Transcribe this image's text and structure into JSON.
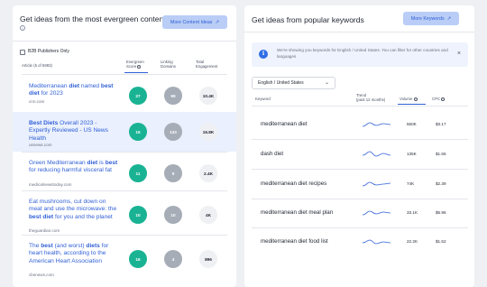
{
  "left_panel": {
    "title": "Get ideas from the most evergreen content",
    "button_label": "More Content Ideas",
    "checkbox_label": "B2B Publishers Only",
    "col_article": "Article (5 of 5993)",
    "col_evergreen_1": "Evergreen",
    "col_evergreen_2": "Score",
    "col_linking_1": "Linking",
    "col_linking_2": "Domains",
    "col_total_1": "Total",
    "col_total_2": "Engagement",
    "articles": [
      {
        "segs": [
          {
            "t": "Mediterranean ",
            "b": false
          },
          {
            "t": "diet",
            "b": true
          },
          {
            "t": " named ",
            "b": false
          },
          {
            "t": "best diet",
            "b": true
          },
          {
            "t": " for 2023",
            "b": false
          }
        ],
        "domain": "cnn.com",
        "score": "27",
        "linking": "99",
        "engagement": "10.4K"
      },
      {
        "segs": [
          {
            "t": "Best Diets",
            "b": true
          },
          {
            "t": " Overall 2023 - Expertly Reviewed - US News Health",
            "b": false
          }
        ],
        "domain": "usnews.com",
        "score": "15",
        "linking": "133",
        "engagement": "16.8K"
      },
      {
        "segs": [
          {
            "t": "Green Mediterranean ",
            "b": false
          },
          {
            "t": "diet",
            "b": true
          },
          {
            "t": " is ",
            "b": false
          },
          {
            "t": "best",
            "b": true
          },
          {
            "t": " for reducing harmful visceral fat",
            "b": false
          }
        ],
        "domain": "medicalnewstoday.com",
        "score": "11",
        "linking": "9",
        "engagement": "2.4K"
      },
      {
        "segs": [
          {
            "t": "Eat mushrooms, cut down on meat and use the microwave: the ",
            "b": false
          },
          {
            "t": "best diet",
            "b": true
          },
          {
            "t": " for you and the planet",
            "b": false
          }
        ],
        "domain": "theguardian.com",
        "score": "10",
        "linking": "10",
        "engagement": "4K"
      },
      {
        "segs": [
          {
            "t": "The ",
            "b": false
          },
          {
            "t": "best",
            "b": true
          },
          {
            "t": " (and worst) ",
            "b": false
          },
          {
            "t": "diets",
            "b": true
          },
          {
            "t": " for heart health, according to the American Heart Association",
            "b": false
          }
        ],
        "domain": "cbsnews.com",
        "score": "16",
        "linking": "4",
        "engagement": "896"
      }
    ]
  },
  "right_panel": {
    "title": "Get ideas from popular keywords",
    "button_label": "More Keywords",
    "notice": "We're showing you keywords for English / United States. You can filter for other countries and languages",
    "select_value": "English / United States",
    "col_keyword": "Keyword",
    "col_trend_1": "Trend",
    "col_trend_2": "(past 12 months)",
    "col_volume": "Volume",
    "col_cpc": "CPC",
    "keywords": [
      {
        "keyword": "mediterranean diet",
        "volume": "550K",
        "cpc": "$3.17"
      },
      {
        "keyword": "dash diet",
        "volume": "135K",
        "cpc": "$1.65"
      },
      {
        "keyword": "mediterranean diet recipes",
        "volume": "74K",
        "cpc": "$2.39"
      },
      {
        "keyword": "mediterranean diet meal plan",
        "volume": "33.1K",
        "cpc": "$5.96"
      },
      {
        "keyword": "mediterranean diet food list",
        "volume": "22.2K",
        "cpc": "$1.52"
      }
    ]
  }
}
